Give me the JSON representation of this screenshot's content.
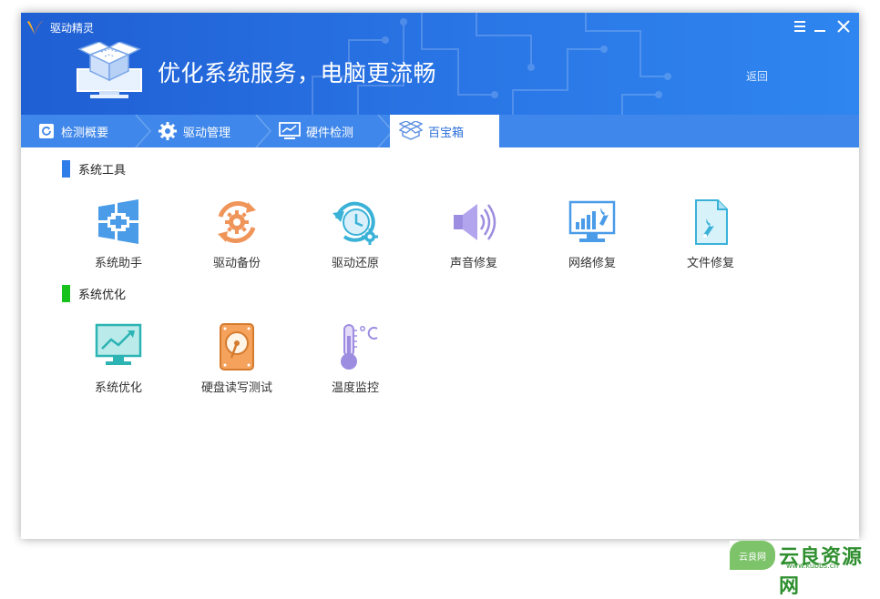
{
  "app": {
    "name": "驱动精灵",
    "slogan": "优化系统服务，电脑更流畅",
    "back_label": "返回"
  },
  "window_controls": [
    {
      "name": "menu-icon"
    },
    {
      "name": "minimize-icon"
    },
    {
      "name": "close-icon"
    }
  ],
  "tabs": [
    {
      "label": "检测概要",
      "icon": "refresh-icon",
      "active": false
    },
    {
      "label": "驱动管理",
      "icon": "gear-icon",
      "active": false
    },
    {
      "label": "硬件检测",
      "icon": "monitor-chart-icon",
      "active": false
    },
    {
      "label": "百宝箱",
      "icon": "toolbox-icon",
      "active": true
    }
  ],
  "sections": [
    {
      "title": "系统工具",
      "color": "#2f7de8",
      "items": [
        {
          "label": "系统助手",
          "icon": "windows-plus-icon"
        },
        {
          "label": "驱动备份",
          "icon": "gear-backup-icon"
        },
        {
          "label": "驱动还原",
          "icon": "clock-restore-icon"
        },
        {
          "label": "声音修复",
          "icon": "speaker-icon"
        },
        {
          "label": "网络修复",
          "icon": "network-wrench-icon"
        },
        {
          "label": "文件修复",
          "icon": "file-wrench-icon"
        }
      ]
    },
    {
      "title": "系统优化",
      "color": "#17c21c",
      "items": [
        {
          "label": "系统优化",
          "icon": "monitor-trend-icon"
        },
        {
          "label": "硬盘读写测试",
          "icon": "harddisk-icon"
        },
        {
          "label": "温度监控",
          "icon": "thermometer-icon"
        }
      ]
    }
  ],
  "watermark": {
    "badge": "云良网",
    "text": "云良资源网",
    "url": "www.kubbs.cn"
  }
}
